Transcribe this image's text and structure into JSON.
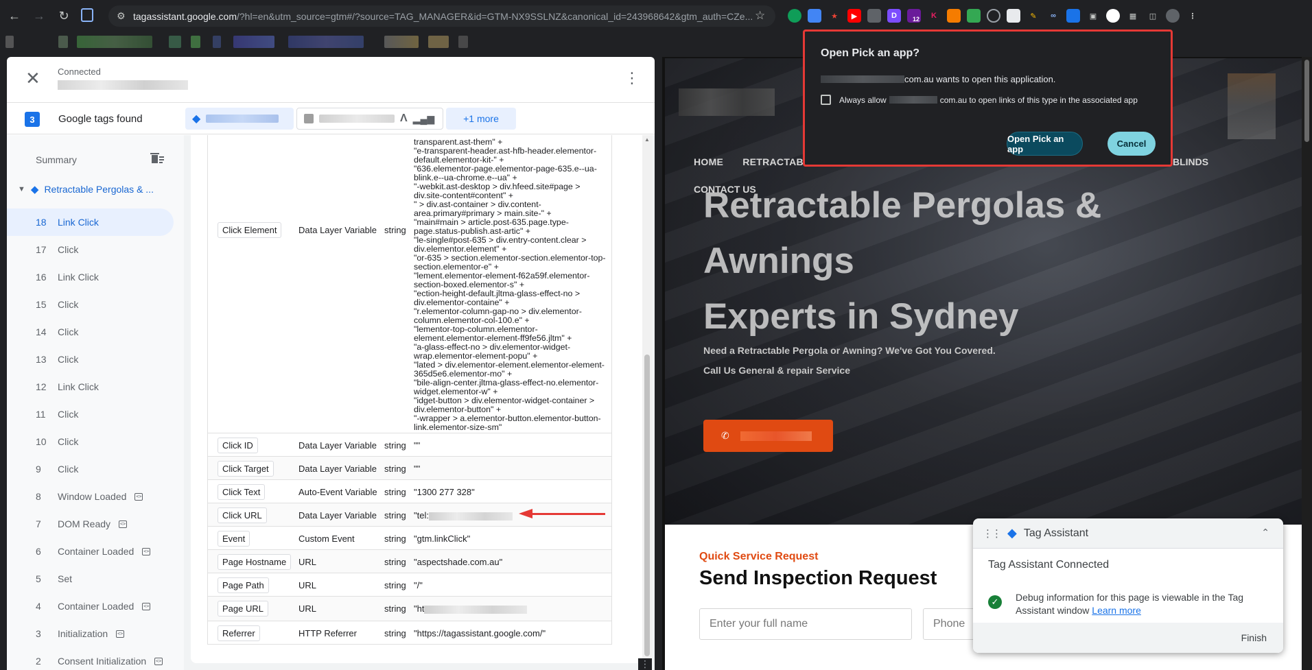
{
  "browser": {
    "url_host": "tagassistant.google.com",
    "url_rest": "/?hl=en&utm_source=gtm#/?source=TAG_MANAGER&id=GTM-NX9SSLNZ&canonical_id=243968642&gtm_auth=CZe...",
    "ext_badge": "12"
  },
  "tag_assistant": {
    "status": "Connected",
    "tags_count": "3",
    "tags_found_label": "Google tags found",
    "more_label": "+1 more",
    "summary_label": "Summary",
    "page_label": "Retractable Pergolas & ...",
    "events": [
      {
        "num": "18",
        "label": "Link Click",
        "code": false,
        "active": true
      },
      {
        "num": "17",
        "label": "Click",
        "code": false
      },
      {
        "num": "16",
        "label": "Link Click",
        "code": false
      },
      {
        "num": "15",
        "label": "Click",
        "code": false
      },
      {
        "num": "14",
        "label": "Click",
        "code": false
      },
      {
        "num": "13",
        "label": "Click",
        "code": false
      },
      {
        "num": "12",
        "label": "Link Click",
        "code": false
      },
      {
        "num": "11",
        "label": "Click",
        "code": false
      },
      {
        "num": "10",
        "label": "Click",
        "code": false
      },
      {
        "num": "9",
        "label": "Click",
        "code": false
      },
      {
        "num": "8",
        "label": "Window Loaded",
        "code": true
      },
      {
        "num": "7",
        "label": "DOM Ready",
        "code": true
      },
      {
        "num": "6",
        "label": "Container Loaded",
        "code": true
      },
      {
        "num": "5",
        "label": "Set",
        "code": false
      },
      {
        "num": "4",
        "label": "Container Loaded",
        "code": true
      },
      {
        "num": "3",
        "label": "Initialization",
        "code": true
      },
      {
        "num": "2",
        "label": "Consent Initialization",
        "code": true
      }
    ],
    "click_element": {
      "name": "Click Element",
      "type": "Data Layer Variable",
      "return_type": "string",
      "value": "transparent.ast-them\" +\n\"e-transparent-header.ast-hfb-header.elementor-default.elementor-kit-\" +\n\"636.elementor-page.elementor-page-635.e--ua-blink.e--ua-chrome.e--ua\" +\n\"-webkit.ast-desktop > div.hfeed.site#page > div.site-content#content\" +\n\" > div.ast-container > div.content-area.primary#primary > main.site-\" +\n\"main#main > article.post-635.page.type-page.status-publish.ast-artic\" +\n\"le-single#post-635 > div.entry-content.clear > div.elementor.element\" +\n\"or-635 > section.elementor-section.elementor-top-section.elementor-e\" +\n\"lement.elementor-element-f62a59f.elementor-section-boxed.elementor-s\" +\n\"ection-height-default.jltma-glass-effect-no > div.elementor-containe\" +\n\"r.elementor-column-gap-no > div.elementor-column.elementor-col-100.e\" +\n\"lementor-top-column.elementor-element.elementor-element-ff9fe56.jltm\" +\n\"a-glass-effect-no > div.elementor-widget-wrap.elementor-element-popu\" +\n\"lated > div.elementor-element.elementor-element-365d5e6.elementor-mo\" +\n\"bile-align-center.jltma-glass-effect-no.elementor-widget.elementor-w\" +\n\"idget-button > div.elementor-widget-container > div.elementor-button\" +\n\"-wrapper > a.elementor-button.elementor-button-link.elementor-size-sm\""
    },
    "variables": [
      {
        "name": "Click ID",
        "type": "Data Layer Variable",
        "return_type": "string",
        "value": "\"\""
      },
      {
        "name": "Click Target",
        "type": "Data Layer Variable",
        "return_type": "string",
        "value": "\"\""
      },
      {
        "name": "Click Text",
        "type": "Auto-Event Variable",
        "return_type": "string",
        "value": "\"1300 277 328\""
      },
      {
        "name": "Click URL",
        "type": "Data Layer Variable",
        "return_type": "string",
        "value": "\"tel:",
        "redacted": true
      },
      {
        "name": "Event",
        "type": "Custom Event",
        "return_type": "string",
        "value": "\"gtm.linkClick\""
      },
      {
        "name": "Page Hostname",
        "type": "URL",
        "return_type": "string",
        "value": "\"aspectshade.com.au\""
      },
      {
        "name": "Page Path",
        "type": "URL",
        "return_type": "string",
        "value": "\"/\""
      },
      {
        "name": "Page URL",
        "type": "URL",
        "return_type": "string",
        "value": "\"ht",
        "redacted": true
      },
      {
        "name": "Referrer",
        "type": "HTTP Referrer",
        "return_type": "string",
        "value": "\"https://tagassistant.google.com/\""
      }
    ]
  },
  "website": {
    "nav": [
      "HOME",
      "RETRACTABL"
    ],
    "nav_right": "BLINDS",
    "contact": "CONTACT US",
    "hero_title_1": "Retractable Pergolas &",
    "hero_title_2": "Awnings",
    "hero_title_3": "Experts in Sydney",
    "hero_sub": "Need a Retractable Pergola or Awning? We've Got You Covered.",
    "hero_sub2": "Call Us General & repair Service",
    "quick_service": "Quick Service Request",
    "form_title": "Send Inspection Request",
    "name_placeholder": "Enter your full name",
    "phone_placeholder": "Phone"
  },
  "toast": {
    "title": "Tag Assistant",
    "connected": "Tag Assistant Connected",
    "info": "Debug information for this page is viewable in the Tag Assistant window",
    "learn_more": "Learn more",
    "finish": "Finish"
  },
  "dialog": {
    "title": "Open Pick an app?",
    "text_suffix": "com.au wants to open this application.",
    "always_prefix": "Always allow",
    "always_suffix": "com.au to open links of this type in the associated app",
    "open_button": "Open Pick an app",
    "cancel_button": "Cancel"
  }
}
